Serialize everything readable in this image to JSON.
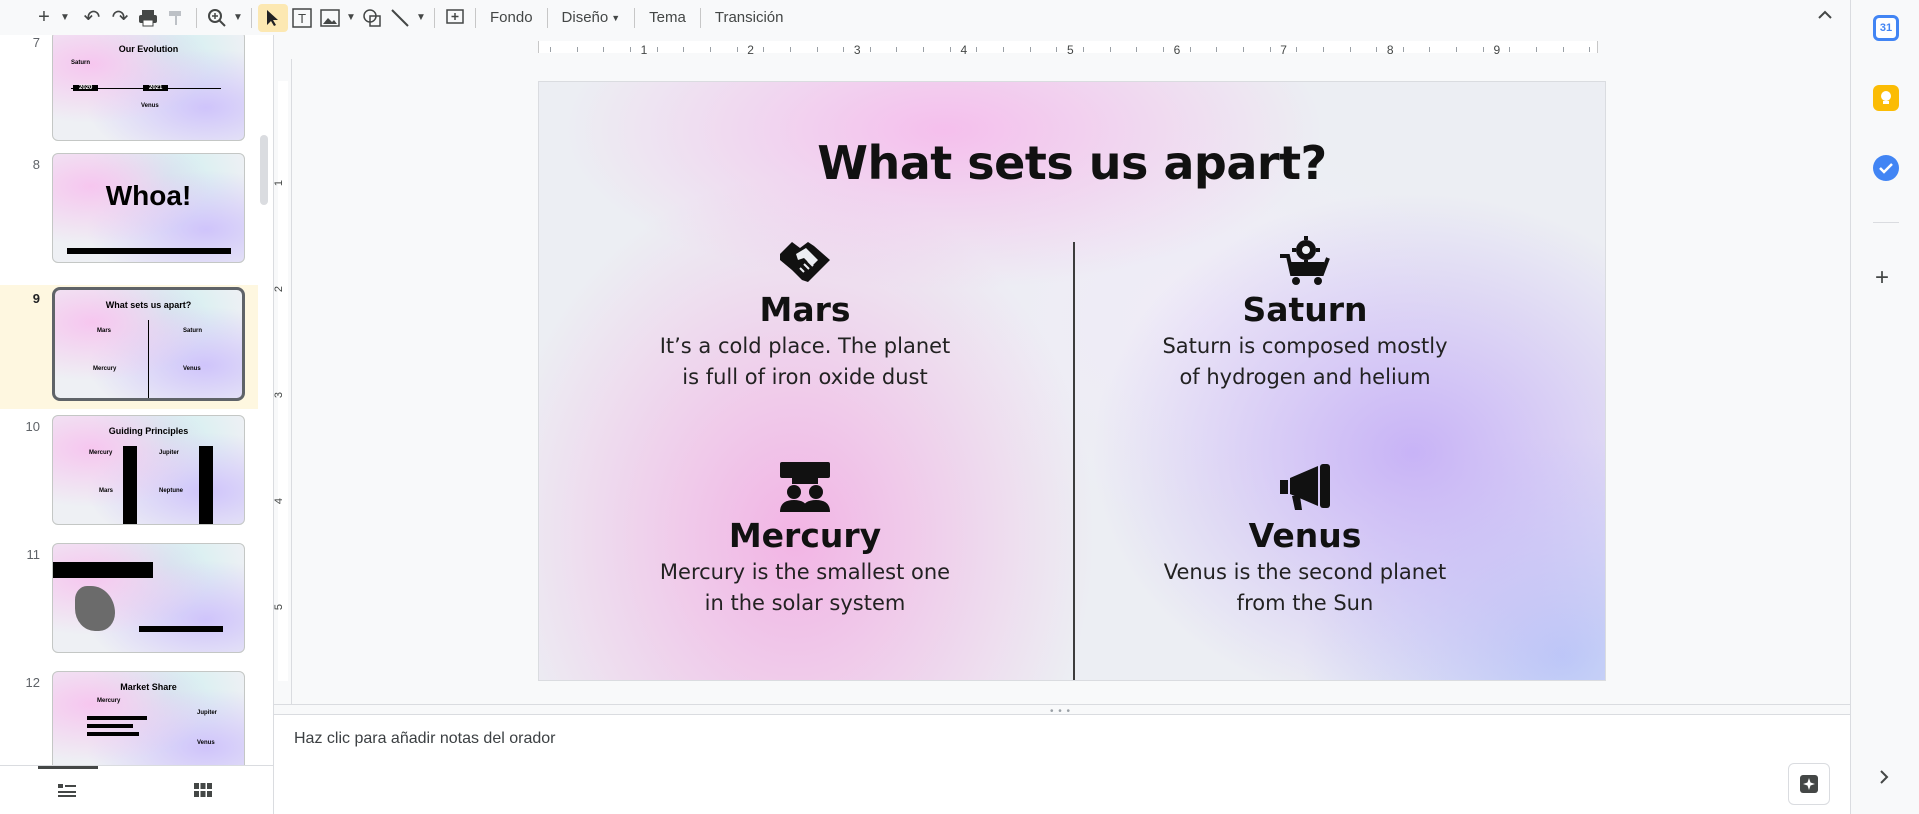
{
  "toolbar": {
    "icons": [
      "plus-icon",
      "caret-down-icon",
      "undo-icon",
      "redo-icon",
      "print-icon",
      "paint-format-icon",
      "zoom-icon",
      "caret-down-icon",
      "select-cursor-icon",
      "text-box-icon",
      "image-icon",
      "shape-icon",
      "line-icon",
      "add-comment-icon"
    ],
    "fondo": "Fondo",
    "diseno": "Diseño",
    "tema": "Tema",
    "transicion": "Transición"
  },
  "ruler_top": [
    "1",
    "2",
    "3",
    "4",
    "5",
    "6",
    "7",
    "8",
    "9"
  ],
  "ruler_left": [
    "1",
    "2",
    "3",
    "4",
    "5"
  ],
  "filmstrip": {
    "selected": 9,
    "slides": [
      {
        "number": "7",
        "title": "Our Evolution",
        "labels": [
          "Saturn",
          "Venus",
          "2020",
          "2021"
        ]
      },
      {
        "number": "8",
        "title": "Whoa!"
      },
      {
        "number": "9",
        "title": "What sets us apart?",
        "labels": [
          "Mars",
          "Saturn",
          "Mercury",
          "Venus"
        ]
      },
      {
        "number": "10",
        "title": "Guiding Principles",
        "labels": [
          "Mercury",
          "Jupiter",
          "Mars",
          "Neptune"
        ]
      },
      {
        "number": "11",
        "title": ""
      },
      {
        "number": "12",
        "title": "Market Share",
        "labels": [
          "Mercury",
          "Jupiter",
          "Venus"
        ]
      }
    ]
  },
  "slide": {
    "title": "What sets us apart?",
    "blocks": [
      {
        "icon": "handshake-icon",
        "heading": "Mars",
        "text_line1": "It’s a cold place. The planet",
        "text_line2": "is full of iron oxide dust"
      },
      {
        "icon": "cart-gear-icon",
        "heading": "Saturn",
        "text_line1": "Saturn is composed mostly",
        "text_line2": "of hydrogen and helium"
      },
      {
        "icon": "team-icon",
        "heading": "Mercury",
        "text_line1": "Mercury is the smallest one",
        "text_line2": "in the solar system"
      },
      {
        "icon": "megaphone-icon",
        "heading": "Venus",
        "text_line1": "Venus is the second planet",
        "text_line2": "from the Sun"
      }
    ]
  },
  "notes": {
    "placeholder": "Haz clic para añadir notas del orador"
  },
  "side_panel": {
    "calendar_day": "31"
  }
}
